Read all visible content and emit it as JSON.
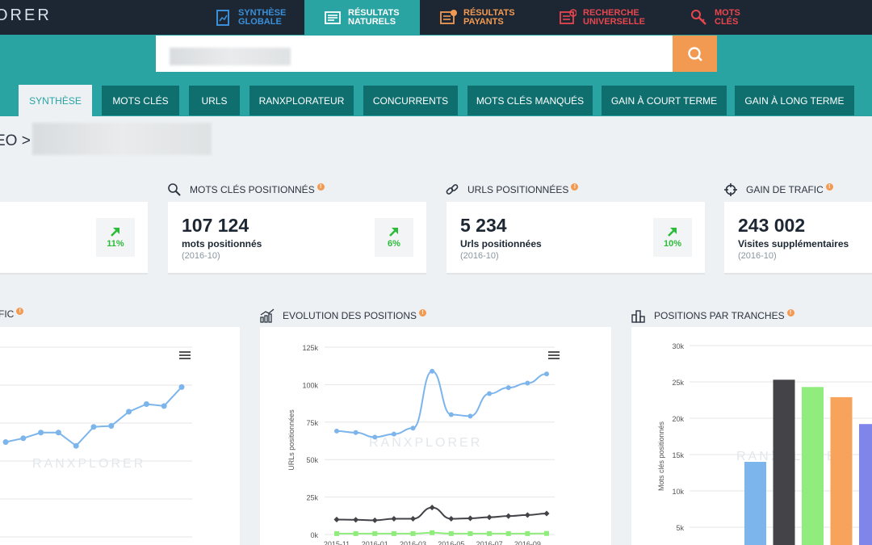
{
  "app": {
    "logo_text": "ORER"
  },
  "topnav": [
    {
      "line1": "SYNTHÈSE",
      "line2": "GLOBALE",
      "color": "#3b8fd9",
      "icon": "report-icon"
    },
    {
      "line1": "RÉSULTATS",
      "line2": "NATURELS",
      "color": "#ffffff",
      "icon": "list-icon"
    },
    {
      "line1": "RÉSULTATS",
      "line2": "PAYANTS",
      "color": "#f39a52",
      "icon": "paid-list-icon"
    },
    {
      "line1": "RECHERCHE",
      "line2": "UNIVERSELLE",
      "color": "#e8464e",
      "icon": "universal-icon"
    },
    {
      "line1": "MOTS",
      "line2": "CLÉS",
      "color": "#e8464e",
      "icon": "key-icon"
    }
  ],
  "search": {
    "value": ""
  },
  "tabs": [
    "SYNTHÈSE",
    "MOTS CLÉS",
    "URLS",
    "RANXPLORATEUR",
    "CONCURRENTS",
    "MOTS CLÉS MANQUÉS",
    "GAIN À COURT TERME",
    "GAIN À LONG TERME"
  ],
  "breadcrumb": {
    "prefix": "EO >"
  },
  "stats": [
    {
      "title": "MOTS CLÉS POSITIONNÉS",
      "icon": "search-icon",
      "value": "107 124",
      "label": "mots positionnés",
      "date": "(2016-10)",
      "trend": "6%"
    },
    {
      "title": "URLS POSITIONNÉES",
      "icon": "link-icon",
      "value": "5 234",
      "label": "Urls positionnées",
      "date": "(2016-10)",
      "trend": "10%"
    },
    {
      "title": "GAIN DE TRAFIC",
      "icon": "crosshair-icon",
      "value": "243 002",
      "label": "Visites supplémentaires",
      "date": "(2016-10)"
    }
  ],
  "first_card": {
    "trend": "11%"
  },
  "info_mark": "!",
  "section_titles": {
    "traffic": "FIC",
    "evolution": "EVOLUTION DES POSITIONS",
    "tranches": "POSITIONS PAR TRANCHES"
  },
  "watermark": "RANXPLORER",
  "colors": {
    "accent": "#2aa3a3",
    "dark_nav": "#1c2733",
    "orange": "#f39a52",
    "green": "#2dbb3a"
  },
  "chart_data": [
    {
      "type": "line",
      "title": "",
      "series": [
        {
          "values": [
            0.5,
            0.52,
            0.55,
            0.55,
            0.48,
            0.58,
            0.585,
            0.66,
            0.7,
            0.69,
            0.79
          ],
          "color": "#7cb5ec"
        }
      ]
    },
    {
      "type": "line",
      "title": "EVOLUTION DES POSITIONS",
      "ylabel": "URLs positionnées",
      "ylim": [
        0,
        125000
      ],
      "yticks": [
        "0k",
        "25k",
        "50k",
        "75k",
        "100k",
        "125k"
      ],
      "xticks": [
        "2015-11",
        "2016-01",
        "2016-03",
        "2016-05",
        "2016-07",
        "2016-09"
      ],
      "x": [
        "2015-11",
        "2015-12",
        "2016-01",
        "2016-02",
        "2016-03",
        "2016-04",
        "2016-05",
        "2016-06",
        "2016-07",
        "2016-08",
        "2016-09",
        "2016-10"
      ],
      "series": [
        {
          "values": [
            69000,
            68000,
            65000,
            67000,
            71000,
            109000,
            80000,
            79000,
            94000,
            98000,
            101000,
            107124
          ],
          "color": "#7cb5ec"
        },
        {
          "values": [
            10000,
            9800,
            9500,
            10500,
            10500,
            18000,
            10500,
            10800,
            11500,
            12300,
            13000,
            14000
          ],
          "color": "#434348"
        },
        {
          "values": [
            600,
            600,
            600,
            600,
            600,
            1200,
            600,
            600,
            600,
            600,
            600,
            700
          ],
          "color": "#90ed7d"
        }
      ]
    },
    {
      "type": "bar",
      "title": "POSITIONS PAR TRANCHES",
      "ylabel": "Mots clés positionnés",
      "ylim": [
        5000,
        30000
      ],
      "yticks": [
        "5k",
        "10k",
        "15k",
        "20k",
        "25k",
        "30k"
      ],
      "values": [
        14000,
        25300,
        24300,
        22900,
        19200
      ],
      "colors": [
        "#7cb5ec",
        "#434348",
        "#90ed7d",
        "#f7a35c",
        "#8085e9"
      ]
    }
  ]
}
